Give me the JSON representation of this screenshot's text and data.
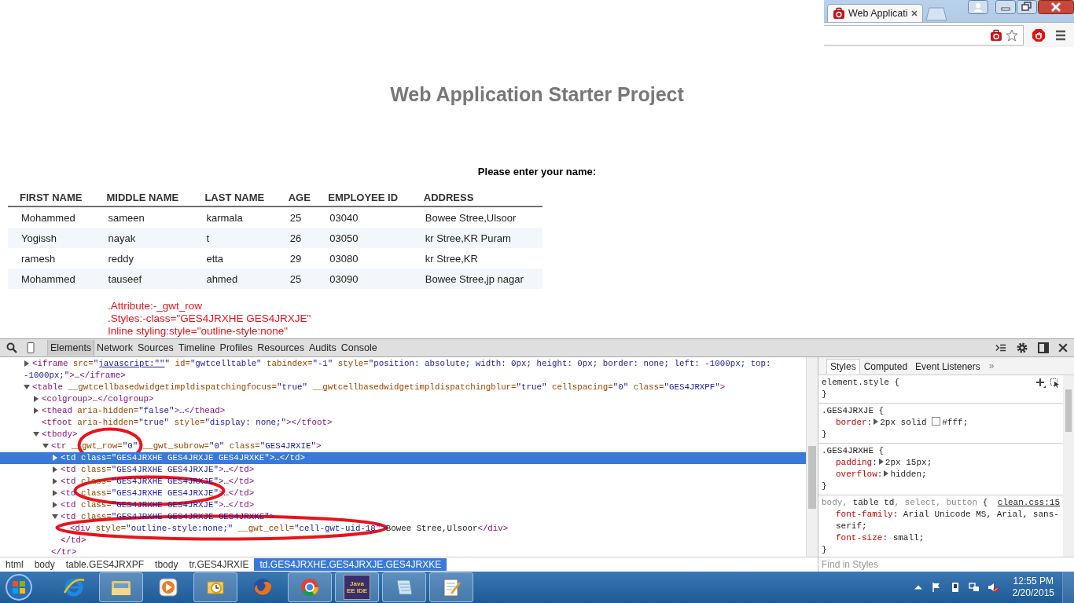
{
  "browser": {
    "tab": {
      "title": "Web Applicati",
      "selected": true
    }
  },
  "page": {
    "title": "Web Application Starter Project",
    "prompt": "Please enter your name:",
    "table": {
      "columns": [
        "FIRST NAME",
        "MIDDLE NAME",
        "LAST NAME",
        "AGE",
        "EMPLOYEE ID",
        "ADDRESS"
      ],
      "rows": [
        [
          "Mohammed",
          "sameen",
          "karmala",
          "25",
          "03040",
          "Bowee Stree,Ulsoor"
        ],
        [
          "Yogissh",
          "nayak",
          "t",
          "26",
          "03050",
          "kr Stree,KR Puram"
        ],
        [
          "ramesh",
          "reddy",
          "etta",
          "29",
          "03080",
          "kr Stree,KR"
        ],
        [
          "Mohammed",
          "tauseef",
          "ahmed",
          "25",
          "03090",
          "Bowee Stree,jp nagar"
        ]
      ]
    },
    "annotations": [
      ".Attribute:-_gwt_row",
      ".Styles:-class=\"GES4JRXHE GES4JRXJE\"",
      "Inline styling:style=\"outline-style:none\""
    ]
  },
  "devtools": {
    "tabs": [
      {
        "label": "Elements",
        "selected": true
      },
      {
        "label": "Network",
        "selected": false
      },
      {
        "label": "Sources",
        "selected": false
      },
      {
        "label": "Timeline",
        "selected": false
      },
      {
        "label": "Profiles",
        "selected": false
      },
      {
        "label": "Resources",
        "selected": false
      },
      {
        "label": "Audits",
        "selected": false
      },
      {
        "label": "Console",
        "selected": false
      }
    ],
    "tree": [
      {
        "kind": "element",
        "expanded": false,
        "selected": false,
        "lines": [
          [
            {
              "kind": "tag",
              "text": "<iframe"
            },
            {
              "kind": "attr",
              "text": " src="
            },
            {
              "kind": "value",
              "text": "\""
            },
            {
              "kind": "link",
              "text": "javascript:\"\""
            },
            {
              "kind": "value",
              "text": "\""
            },
            {
              "kind": "attr",
              "text": " id="
            },
            {
              "kind": "value",
              "text": "\"gwtcelltable\""
            },
            {
              "kind": "attr",
              "text": " tabindex="
            },
            {
              "kind": "value",
              "text": "\"-1\""
            },
            {
              "kind": "attr",
              "text": " style="
            },
            {
              "kind": "value",
              "text": "\"position: absolute; width: 0px; height: 0px; border: none; left: -1000px; top:"
            }
          ],
          [
            {
              "kind": "value",
              "text": "-1000px;\""
            },
            {
              "kind": "tag",
              "text": ">"
            },
            {
              "kind": "text",
              "text": "…"
            },
            {
              "kind": "tag",
              "text": "</iframe>"
            }
          ]
        ]
      },
      {
        "kind": "element",
        "expanded": true,
        "selected": false,
        "lines": [
          [
            {
              "kind": "tag",
              "text": "<table"
            },
            {
              "kind": "attr",
              "text": " __gwtcellbasedwidgetimpldispatchingfocus="
            },
            {
              "kind": "value",
              "text": "\"true\""
            },
            {
              "kind": "attr",
              "text": " __gwtcellbasedwidgetimpldispatchingblur="
            },
            {
              "kind": "value",
              "text": "\"true\""
            },
            {
              "kind": "attr",
              "text": " cellspacing="
            },
            {
              "kind": "value",
              "text": "\"0\""
            },
            {
              "kind": "attr",
              "text": " class="
            },
            {
              "kind": "value",
              "text": "\"GES4JRXPF\""
            },
            {
              "kind": "tag",
              "text": ">"
            }
          ]
        ],
        "children": [
          {
            "kind": "element",
            "expanded": false,
            "selected": false,
            "lines": [
              [
                {
                  "kind": "tag",
                  "text": "<colgroup>"
                },
                {
                  "kind": "text",
                  "text": "…"
                },
                {
                  "kind": "tag",
                  "text": "</colgroup>"
                }
              ]
            ]
          },
          {
            "kind": "element",
            "expanded": false,
            "selected": false,
            "lines": [
              [
                {
                  "kind": "tag",
                  "text": "<thead"
                },
                {
                  "kind": "attr",
                  "text": " aria-hidden="
                },
                {
                  "kind": "value",
                  "text": "\"false\""
                },
                {
                  "kind": "tag",
                  "text": ">"
                },
                {
                  "kind": "text",
                  "text": "…"
                },
                {
                  "kind": "tag",
                  "text": "</thead>"
                }
              ]
            ]
          },
          {
            "kind": "leaf",
            "selected": false,
            "lines": [
              [
                {
                  "kind": "tag",
                  "text": "<tfoot"
                },
                {
                  "kind": "attr",
                  "text": " aria-hidden="
                },
                {
                  "kind": "value",
                  "text": "\"true\""
                },
                {
                  "kind": "attr",
                  "text": " style="
                },
                {
                  "kind": "value",
                  "text": "\"display: none;\""
                },
                {
                  "kind": "tag",
                  "text": "></tfoot>"
                }
              ]
            ]
          },
          {
            "kind": "element",
            "expanded": true,
            "selected": false,
            "lines": [
              [
                {
                  "kind": "tag",
                  "text": "<tbody>"
                }
              ]
            ],
            "children": [
              {
                "kind": "element",
                "expanded": true,
                "selected": false,
                "lines": [
                  [
                    {
                      "kind": "tag",
                      "text": "<tr"
                    },
                    {
                      "kind": "attr",
                      "text": " __gwt_row="
                    },
                    {
                      "kind": "value",
                      "text": "\"0\""
                    },
                    {
                      "kind": "attr",
                      "text": " __gwt_subrow="
                    },
                    {
                      "kind": "value",
                      "text": "\"0\""
                    },
                    {
                      "kind": "attr",
                      "text": " class="
                    },
                    {
                      "kind": "value",
                      "text": "\"GES4JRXIE\""
                    },
                    {
                      "kind": "tag",
                      "text": ">"
                    }
                  ]
                ],
                "close": [
                  {
                    "kind": "tag",
                    "text": "</tr>"
                  }
                ],
                "children": [
                  {
                    "kind": "element",
                    "expanded": false,
                    "selected": true,
                    "lines": [
                      [
                        {
                          "kind": "tag",
                          "text": "<td"
                        },
                        {
                          "kind": "attr",
                          "text": " class="
                        },
                        {
                          "kind": "value",
                          "text": "\"GES4JRXHE GES4JRXJE GES4JRXKE\""
                        },
                        {
                          "kind": "tag",
                          "text": ">"
                        },
                        {
                          "kind": "text",
                          "text": "…"
                        },
                        {
                          "kind": "tag",
                          "text": "</td>"
                        }
                      ]
                    ]
                  },
                  {
                    "kind": "element",
                    "expanded": false,
                    "selected": false,
                    "lines": [
                      [
                        {
                          "kind": "tag",
                          "text": "<td"
                        },
                        {
                          "kind": "attr",
                          "text": " class="
                        },
                        {
                          "kind": "value",
                          "text": "\"GES4JRXHE GES4JRXJE\""
                        },
                        {
                          "kind": "tag",
                          "text": ">"
                        },
                        {
                          "kind": "text",
                          "text": "…"
                        },
                        {
                          "kind": "tag",
                          "text": "</td>"
                        }
                      ]
                    ]
                  },
                  {
                    "kind": "element",
                    "expanded": false,
                    "selected": false,
                    "lines": [
                      [
                        {
                          "kind": "tag",
                          "text": "<td"
                        },
                        {
                          "kind": "attr",
                          "text": " class="
                        },
                        {
                          "kind": "value",
                          "text": "\"GES4JRXHE GES4JRXJE\""
                        },
                        {
                          "kind": "tag",
                          "text": ">"
                        },
                        {
                          "kind": "text",
                          "text": "…"
                        },
                        {
                          "kind": "tag",
                          "text": "</td>"
                        }
                      ]
                    ]
                  },
                  {
                    "kind": "element",
                    "expanded": false,
                    "selected": false,
                    "lines": [
                      [
                        {
                          "kind": "tag",
                          "text": "<td"
                        },
                        {
                          "kind": "attr",
                          "text": " class="
                        },
                        {
                          "kind": "value",
                          "text": "\"GES4JRXHE GES4JRXJE\""
                        },
                        {
                          "kind": "tag",
                          "text": ">"
                        },
                        {
                          "kind": "text",
                          "text": "…"
                        },
                        {
                          "kind": "tag",
                          "text": "</td>"
                        }
                      ]
                    ]
                  },
                  {
                    "kind": "element",
                    "expanded": false,
                    "selected": false,
                    "lines": [
                      [
                        {
                          "kind": "tag",
                          "text": "<td"
                        },
                        {
                          "kind": "attr",
                          "text": " class="
                        },
                        {
                          "kind": "value",
                          "text": "\"GES4JRXHE GES4JRXJE\""
                        },
                        {
                          "kind": "tag",
                          "text": ">"
                        },
                        {
                          "kind": "text",
                          "text": "…"
                        },
                        {
                          "kind": "tag",
                          "text": "</td>"
                        }
                      ]
                    ]
                  },
                  {
                    "kind": "element",
                    "expanded": true,
                    "selected": false,
                    "lines": [
                      [
                        {
                          "kind": "tag",
                          "text": "<td"
                        },
                        {
                          "kind": "attr",
                          "text": " class="
                        },
                        {
                          "kind": "value",
                          "text": "\"GES4JRXHE GES4JRXJE GES4JRXKE\""
                        },
                        {
                          "kind": "tag",
                          "text": ">"
                        }
                      ]
                    ],
                    "close": [
                      {
                        "kind": "tag",
                        "text": "</td>"
                      }
                    ],
                    "children": [
                      {
                        "kind": "leaf",
                        "selected": false,
                        "lines": [
                          [
                            {
                              "kind": "tag",
                              "text": "<div"
                            },
                            {
                              "kind": "attr",
                              "text": " style="
                            },
                            {
                              "kind": "value",
                              "text": "\"outline-style:none;\""
                            },
                            {
                              "kind": "attr",
                              "text": " __gwt_cell="
                            },
                            {
                              "kind": "value",
                              "text": "\"cell-gwt-uid-18\""
                            },
                            {
                              "kind": "tag",
                              "text": ">"
                            },
                            {
                              "kind": "text",
                              "text": "Bowee Stree,Ulsoor"
                            },
                            {
                              "kind": "tag",
                              "text": "</div>"
                            }
                          ]
                        ]
                      }
                    ]
                  }
                ]
              }
            ]
          }
        ]
      }
    ],
    "breadcrumbs": [
      {
        "label": "html",
        "selected": false
      },
      {
        "label": "body",
        "selected": false
      },
      {
        "label": "table.GES4JRXPF",
        "selected": false
      },
      {
        "label": "tbody",
        "selected": false
      },
      {
        "label": "tr.GES4JRXIE",
        "selected": false
      },
      {
        "label": "td.GES4JRXHE.GES4JRXJE.GES4JRXKE",
        "selected": true
      }
    ],
    "styles_pane": {
      "tabs": [
        {
          "label": "Styles",
          "selected": true
        },
        {
          "label": "Computed",
          "selected": false
        },
        {
          "label": "Event Listeners",
          "selected": false
        }
      ],
      "more": "»",
      "rules": [
        {
          "selector": [
            {
              "text": "element.style",
              "matched": true
            }
          ],
          "open": " {",
          "close": "}",
          "tools": true
        },
        {
          "selector": [
            {
              "text": ".GES4JRXJE",
              "matched": true
            }
          ],
          "open": " {",
          "close": "}",
          "props": [
            {
              "name": "border",
              "colon": ":",
              "expandable": true,
              "value": "2px solid ",
              "color": "#ffffff",
              "value_after": "#fff;"
            }
          ]
        },
        {
          "selector": [
            {
              "text": ".GES4JRXHE",
              "matched": true
            }
          ],
          "open": " {",
          "close": "}",
          "props": [
            {
              "name": "padding",
              "colon": ":",
              "expandable": true,
              "value": "2px 15px;"
            },
            {
              "name": "overflow",
              "colon": ":",
              "expandable": true,
              "value": "hidden;"
            }
          ]
        },
        {
          "selector": [
            {
              "text": "body, ",
              "matched": false
            },
            {
              "text": "table td",
              "matched": true
            },
            {
              "text": ", select, button",
              "matched": false
            }
          ],
          "open": " {",
          "close": "}",
          "source": "clean.css:15",
          "props": [
            {
              "name": "font-family",
              "colon": ":",
              "expandable": false,
              "value": " Arial Unicode MS, Arial, sans-serif;"
            },
            {
              "name": "font-size",
              "colon": ":",
              "expandable": false,
              "value": " small;"
            }
          ]
        }
      ],
      "find": {
        "placeholder": "Find in Styles"
      }
    }
  },
  "taskbar": {
    "items": [
      {
        "kind": "ie",
        "running": false
      },
      {
        "kind": "folder",
        "running": true
      },
      {
        "kind": "media",
        "running": false
      },
      {
        "kind": "outlook",
        "running": true
      },
      {
        "kind": "firefox",
        "running": false
      },
      {
        "kind": "chrome",
        "running": true
      },
      {
        "kind": "ide",
        "running": true,
        "label": "Java EE IDE"
      },
      {
        "kind": "notes",
        "running": true
      },
      {
        "kind": "editor",
        "running": true
      }
    ],
    "time": "12:55 PM",
    "date": "2/20/2015"
  }
}
